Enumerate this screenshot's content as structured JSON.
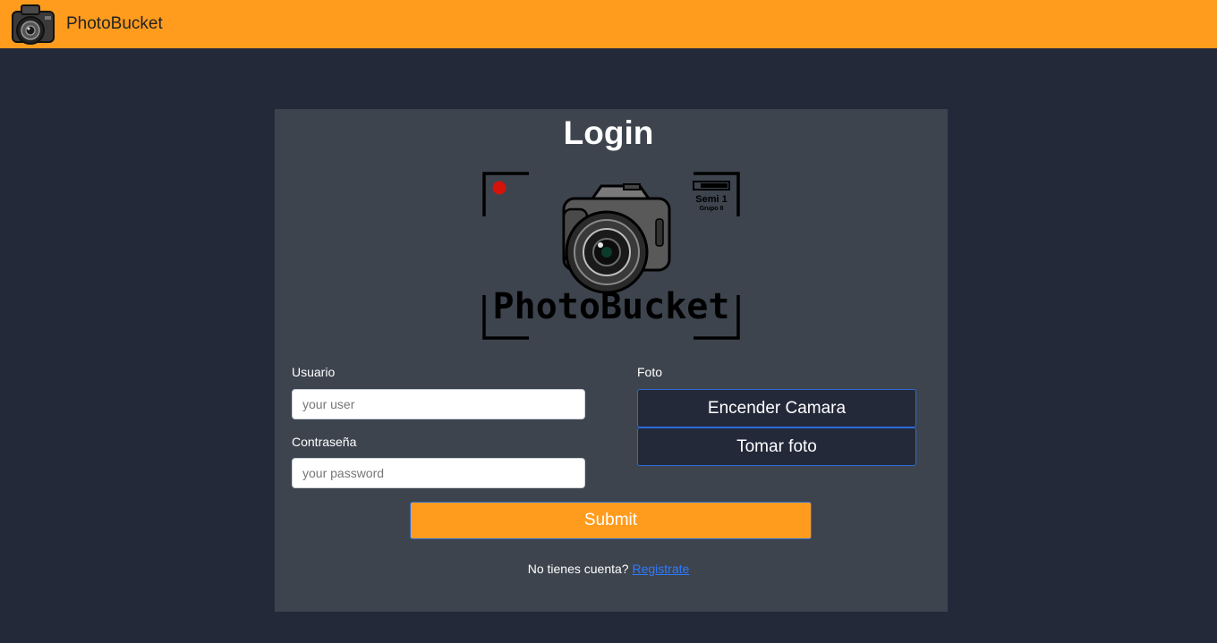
{
  "navbar": {
    "brand": "PhotoBucket",
    "logo_icon": "camera-logo-icon"
  },
  "login": {
    "title": "Login",
    "logo": {
      "icon": "photobucket-camera-logo",
      "brand_text": "PhotoBucket",
      "corner_text_1": "Semi 1",
      "corner_text_2": "Grupo 8"
    },
    "user": {
      "label": "Usuario",
      "placeholder": "your user",
      "value": ""
    },
    "password": {
      "label": "Contraseña",
      "placeholder": "your password",
      "value": ""
    },
    "photo": {
      "label": "Foto",
      "camera_on_label": "Encender Camara",
      "take_photo_label": "Tomar foto"
    },
    "submit_label": "Submit",
    "no_account_text": "No tienes cuenta?",
    "register_link": "Registrate"
  },
  "colors": {
    "navbar": "#ff9c1e",
    "background": "#232939",
    "card": "#3d444e",
    "accent_border": "#2b6cd8",
    "link": "#2e7bff"
  }
}
